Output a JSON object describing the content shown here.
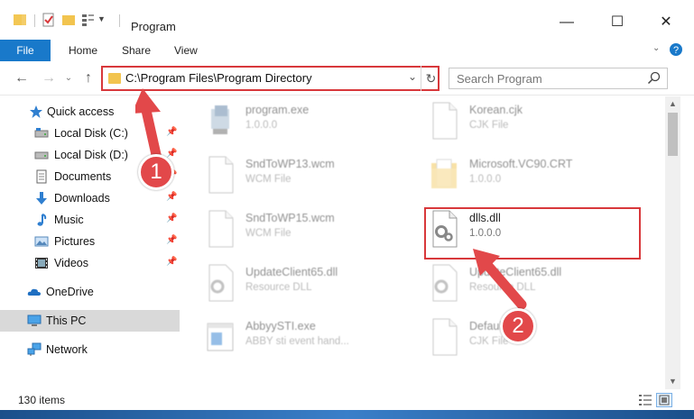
{
  "window": {
    "title": "Program",
    "controls": {
      "minimize": "—",
      "maximize": "☐",
      "close": "✕"
    }
  },
  "ribbon": {
    "tabs": [
      "File",
      "Home",
      "Share",
      "View"
    ]
  },
  "address": {
    "path": "C:\\Program Files\\Program Directory",
    "dropdown_glyph": "⌄",
    "refresh_glyph": "↻"
  },
  "search": {
    "placeholder": "Search Program"
  },
  "nav": {
    "items": [
      {
        "label": "Quick access",
        "icon": "star-icon",
        "pinned": false
      },
      {
        "label": "Local Disk (C:)",
        "icon": "drive-icon",
        "pinned": true
      },
      {
        "label": "Local Disk (D:)",
        "icon": "drive-icon",
        "pinned": true
      },
      {
        "label": "Documents",
        "icon": "documents-icon",
        "pinned": true
      },
      {
        "label": "Downloads",
        "icon": "downloads-icon",
        "pinned": true
      },
      {
        "label": "Music",
        "icon": "music-icon",
        "pinned": true
      },
      {
        "label": "Pictures",
        "icon": "pictures-icon",
        "pinned": true
      },
      {
        "label": "Videos",
        "icon": "videos-icon",
        "pinned": true
      },
      {
        "label": "OneDrive",
        "icon": "cloud-icon",
        "pinned": false
      },
      {
        "label": "This PC",
        "icon": "computer-icon",
        "pinned": false,
        "selected": true
      },
      {
        "label": "Network",
        "icon": "network-icon",
        "pinned": false
      }
    ]
  },
  "files": [
    {
      "name": "program.exe",
      "sub": "1.0.0.0",
      "icon": "exe-icon"
    },
    {
      "name": "Korean.cjk",
      "sub": "CJK File",
      "icon": "blank-file-icon"
    },
    {
      "name": "SndToWP13.wcm",
      "sub": "WCM File",
      "icon": "blank-file-icon"
    },
    {
      "name": "Microsoft.VC90.CRT",
      "sub": "1.0.0.0",
      "icon": "folder-icon"
    },
    {
      "name": "SndToWP15.wcm",
      "sub": "WCM File",
      "icon": "blank-file-icon"
    },
    {
      "name": "dlls.dll",
      "sub": "1.0.0.0",
      "icon": "dll-gear-icon",
      "highlighted": true
    },
    {
      "name": "UpdateClient65.dll",
      "sub": "Resource DLL",
      "icon": "dll-gear-icon"
    },
    {
      "name": "UpdateClient65.dll",
      "sub": "Resource DLL",
      "icon": "dll-gear-icon"
    },
    {
      "name": "AbbyySTI.exe",
      "sub": "ABBY sti event hand...",
      "icon": "exe-window-icon"
    },
    {
      "name": "Default.cjk",
      "sub": "CJK File",
      "icon": "blank-file-icon"
    }
  ],
  "status": {
    "items_text": "130 items"
  },
  "annotations": {
    "step1": "1",
    "step2": "2",
    "color": "#e2484a"
  }
}
